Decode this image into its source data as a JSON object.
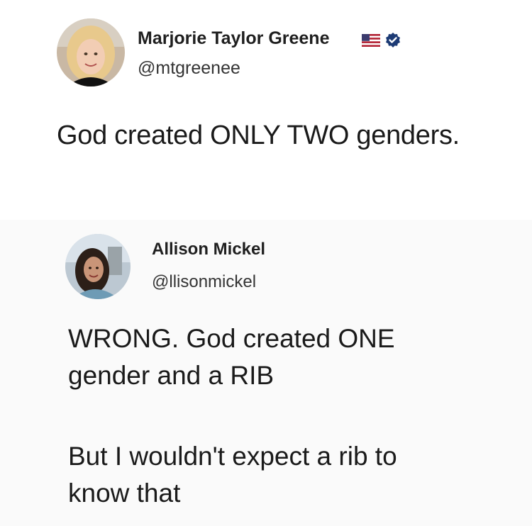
{
  "tweets": [
    {
      "display_name": "Marjorie Taylor Greene",
      "handle": "@mtgreenee",
      "badges": [
        "us-flag-icon",
        "verified-badge-icon"
      ],
      "text_lines": [
        "God created ONLY TWO genders."
      ]
    },
    {
      "display_name": "Allison Mickel",
      "handle": "@llisonmickel",
      "text_lines": [
        "WRONG. God created ONE",
        "gender and a RIB",
        "But I wouldn't expect a rib to",
        "know that"
      ]
    }
  ],
  "colors": {
    "text": "#1a1a1a",
    "verified_badge": "#1d3b75",
    "flag_red": "#b22234",
    "flag_blue": "#3c3b6e"
  }
}
